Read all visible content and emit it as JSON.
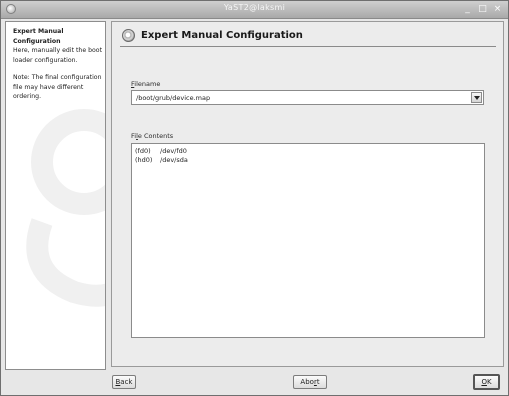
{
  "window": {
    "title": "YaST2@laksmi"
  },
  "titlebar_controls": {
    "minimize": "_",
    "maximize": "□",
    "close": "×"
  },
  "help": {
    "title_line1": "Expert Manual",
    "title_line2": "Configuration",
    "para1_line1": "Here, manually edit the boot",
    "para1_line2": "loader configuration.",
    "para2_line1": "Note: The final configuration",
    "para2_line2": "file may have different",
    "para2_line3": "ordering."
  },
  "main": {
    "title": "Expert Manual Configuration",
    "filename_label_mnemonic": "F",
    "filename_label_rest": "ilename",
    "filename_value": "/boot/grub/device.map",
    "contents_label_pre": "Fi",
    "contents_label_mnemonic": "l",
    "contents_label_rest": "e Contents",
    "file_lines": [
      {
        "dev": "(fd0)",
        "path": "/dev/fd0"
      },
      {
        "dev": "(hd0)",
        "path": "/dev/sda"
      }
    ]
  },
  "buttons": {
    "back_mnemonic": "B",
    "back_rest": "ack",
    "abort_pre": "Abo",
    "abort_mnemonic": "r",
    "abort_rest": "t",
    "ok_mnemonic": "O",
    "ok_rest": "K"
  },
  "icons": {
    "window_menu": "window-menu-icon",
    "header": "yast-module-icon",
    "combo_arrow": "chevron-down-icon",
    "watermark": "opensuse-watermark"
  },
  "colors": {
    "title_bar": "#b5b5b5",
    "panel_bg": "#ffffff",
    "window_bg": "#e7e7e7"
  }
}
